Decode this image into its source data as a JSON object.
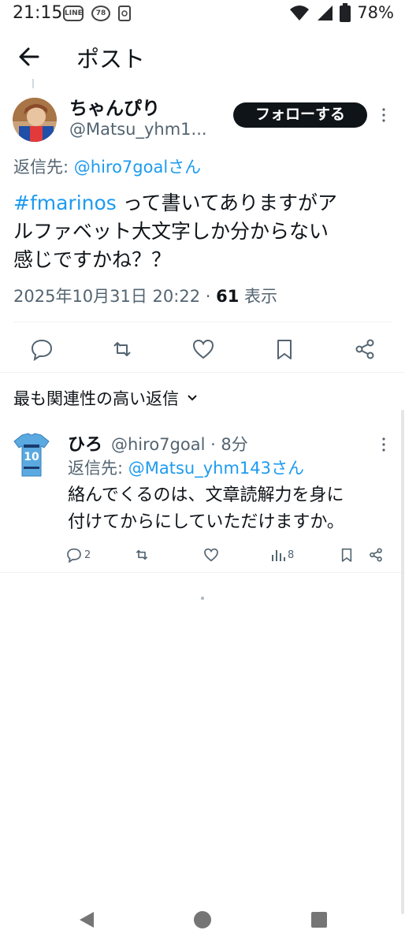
{
  "status_bar": {
    "time": "21:15",
    "line_badge": "LINE",
    "notification_badge": "78",
    "battery": "78%"
  },
  "header": {
    "title": "ポスト"
  },
  "tweet": {
    "author_name": "ちゃんぴり",
    "author_handle": "@Matsu_yhm1...",
    "follow_label": "フォローする",
    "reply_to_prefix": "返信先: ",
    "reply_to_mention": "@hiro7goalさん",
    "hashtag": "#fmarinos",
    "text_line1_rest": " って書いてありますがア",
    "text_line2": "ルファベット大文字しか分からない",
    "text_line3": "感じですかね？？",
    "timestamp": "2025年10月31日 20:22 · ",
    "views_count": "61",
    "views_label": " 表示"
  },
  "replies_section": {
    "sort_label": "最も関連性の高い返信"
  },
  "reply": {
    "name": "ひろ",
    "handle_time": "@hiro7goal · 8分",
    "reply_to_prefix": "返信先: ",
    "reply_to_mention": "@Matsu_yhm143さん",
    "text_line1": "絡んでくるのは、文章読解力を身に",
    "text_line2": "付けてからにしていただけますか。",
    "reply_count": "2",
    "view_count": "8",
    "jersey_number": "10"
  },
  "colors": {
    "accent": "#1d9bf0",
    "text": "#0f1419",
    "secondary": "#536471",
    "divider": "#eff3f4"
  }
}
